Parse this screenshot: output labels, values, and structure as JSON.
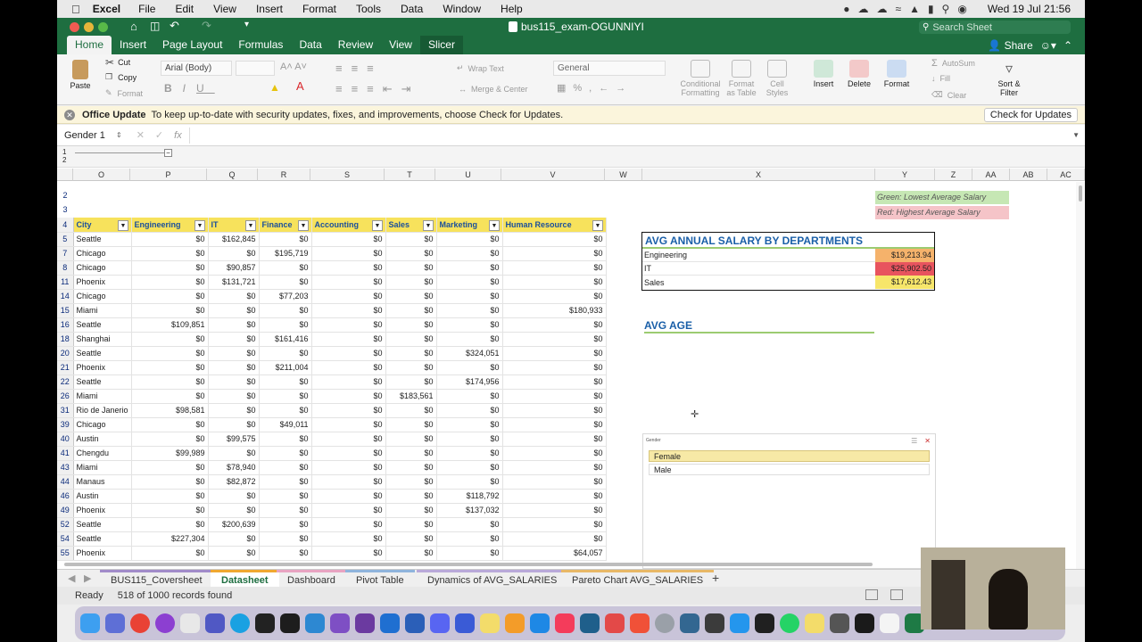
{
  "menubar": {
    "app": "Excel",
    "items": [
      "File",
      "Edit",
      "View",
      "Insert",
      "Format",
      "Tools",
      "Data",
      "Window",
      "Help"
    ],
    "clock": "Wed 19 Jul  21:56"
  },
  "window": {
    "title": "bus115_exam-OGUNNIYI",
    "search_placeholder": "Search Sheet",
    "share": "Share"
  },
  "ribbon_tabs": [
    "Home",
    "Insert",
    "Page Layout",
    "Formulas",
    "Data",
    "Review",
    "View",
    "Slicer"
  ],
  "ribbon": {
    "paste": "Paste",
    "cut": "Cut",
    "copy": "Copy",
    "format": "Format",
    "font": "Arial (Body)",
    "wrap_text": "Wrap Text",
    "merge_center": "Merge & Center",
    "number_format": "General",
    "conditional_formatting": "Conditional Formatting",
    "format_as_table": "Format as Table",
    "cell_styles": "Cell Styles",
    "insert": "Insert",
    "delete": "Delete",
    "format_cells": "Format",
    "autosum": "AutoSum",
    "fill": "Fill",
    "clear": "Clear",
    "sort_filter": "Sort & Filter"
  },
  "update_bar": {
    "title": "Office Update",
    "message": "To keep up-to-date with security updates, fixes, and improvements, choose Check for Updates.",
    "button": "Check for Updates"
  },
  "formula_bar": {
    "name_box": "Gender 1",
    "fx": "fx"
  },
  "columns": [
    "O",
    "P",
    "Q",
    "R",
    "S",
    "T",
    "U",
    "V",
    "W",
    "X",
    "Y",
    "Z",
    "AA",
    "AB",
    "AC"
  ],
  "table": {
    "headers": [
      "City",
      "Engineering",
      "IT",
      "Finance",
      "Accounting",
      "Sales",
      "Marketing",
      "Human Resource"
    ],
    "rows": [
      {
        "rn": "5",
        "cells": [
          "Seattle",
          "$0",
          "$162,845",
          "$0",
          "$0",
          "$0",
          "$0",
          "$0"
        ]
      },
      {
        "rn": "7",
        "cells": [
          "Chicago",
          "$0",
          "$0",
          "$195,719",
          "$0",
          "$0",
          "$0",
          "$0"
        ]
      },
      {
        "rn": "8",
        "cells": [
          "Chicago",
          "$0",
          "$90,857",
          "$0",
          "$0",
          "$0",
          "$0",
          "$0"
        ]
      },
      {
        "rn": "11",
        "cells": [
          "Phoenix",
          "$0",
          "$131,721",
          "$0",
          "$0",
          "$0",
          "$0",
          "$0"
        ]
      },
      {
        "rn": "14",
        "cells": [
          "Chicago",
          "$0",
          "$0",
          "$77,203",
          "$0",
          "$0",
          "$0",
          "$0"
        ]
      },
      {
        "rn": "15",
        "cells": [
          "Miami",
          "$0",
          "$0",
          "$0",
          "$0",
          "$0",
          "$0",
          "$180,933"
        ]
      },
      {
        "rn": "16",
        "cells": [
          "Seattle",
          "$109,851",
          "$0",
          "$0",
          "$0",
          "$0",
          "$0",
          "$0"
        ]
      },
      {
        "rn": "18",
        "cells": [
          "Shanghai",
          "$0",
          "$0",
          "$161,416",
          "$0",
          "$0",
          "$0",
          "$0"
        ]
      },
      {
        "rn": "20",
        "cells": [
          "Seattle",
          "$0",
          "$0",
          "$0",
          "$0",
          "$0",
          "$324,051",
          "$0"
        ]
      },
      {
        "rn": "21",
        "cells": [
          "Phoenix",
          "$0",
          "$0",
          "$211,004",
          "$0",
          "$0",
          "$0",
          "$0"
        ]
      },
      {
        "rn": "22",
        "cells": [
          "Seattle",
          "$0",
          "$0",
          "$0",
          "$0",
          "$0",
          "$174,956",
          "$0"
        ]
      },
      {
        "rn": "26",
        "cells": [
          "Miami",
          "$0",
          "$0",
          "$0",
          "$0",
          "$183,561",
          "$0",
          "$0"
        ]
      },
      {
        "rn": "31",
        "cells": [
          "Rio de Janerio",
          "$98,581",
          "$0",
          "$0",
          "$0",
          "$0",
          "$0",
          "$0"
        ]
      },
      {
        "rn": "39",
        "cells": [
          "Chicago",
          "$0",
          "$0",
          "$49,011",
          "$0",
          "$0",
          "$0",
          "$0"
        ]
      },
      {
        "rn": "40",
        "cells": [
          "Austin",
          "$0",
          "$99,575",
          "$0",
          "$0",
          "$0",
          "$0",
          "$0"
        ]
      },
      {
        "rn": "41",
        "cells": [
          "Chengdu",
          "$99,989",
          "$0",
          "$0",
          "$0",
          "$0",
          "$0",
          "$0"
        ]
      },
      {
        "rn": "43",
        "cells": [
          "Miami",
          "$0",
          "$78,940",
          "$0",
          "$0",
          "$0",
          "$0",
          "$0"
        ]
      },
      {
        "rn": "44",
        "cells": [
          "Manaus",
          "$0",
          "$82,872",
          "$0",
          "$0",
          "$0",
          "$0",
          "$0"
        ]
      },
      {
        "rn": "46",
        "cells": [
          "Austin",
          "$0",
          "$0",
          "$0",
          "$0",
          "$0",
          "$118,792",
          "$0"
        ]
      },
      {
        "rn": "49",
        "cells": [
          "Phoenix",
          "$0",
          "$0",
          "$0",
          "$0",
          "$0",
          "$137,032",
          "$0"
        ]
      },
      {
        "rn": "52",
        "cells": [
          "Seattle",
          "$0",
          "$200,639",
          "$0",
          "$0",
          "$0",
          "$0",
          "$0"
        ]
      },
      {
        "rn": "54",
        "cells": [
          "Seattle",
          "$227,304",
          "$0",
          "$0",
          "$0",
          "$0",
          "$0",
          "$0"
        ]
      },
      {
        "rn": "55",
        "cells": [
          "Phoenix",
          "$0",
          "$0",
          "$0",
          "$0",
          "$0",
          "$0",
          "$64,057"
        ]
      }
    ]
  },
  "legend": {
    "green": "Green: Lowest Average Salary",
    "red": "Red: Highest Average Salary",
    "green_color": "#c6e7b4",
    "red_color": "#f5c4c8"
  },
  "avg_salary": {
    "title": "AVG ANNUAL SALARY BY DEPARTMENTS",
    "rows": [
      {
        "dept": "Engineering",
        "value": "$19,213.94",
        "color": "#f5b26b"
      },
      {
        "dept": "IT",
        "value": "$25,902.50",
        "color": "#e8545e"
      },
      {
        "dept": "Sales",
        "value": "$17,612.43",
        "color": "#f7e66a"
      }
    ]
  },
  "avg_age": {
    "title": "AVG AGE"
  },
  "slicer": {
    "title": "Gender",
    "items": [
      "Female",
      "Male"
    ]
  },
  "sheet_tabs": [
    "BUS115_Coversheet",
    "Datasheet",
    "Dashboard",
    "Pivot Table",
    "Dynamics of AVG_SALARIES",
    "Pareto Chart AVG_SALARIES"
  ],
  "status": {
    "ready": "Ready",
    "records": "518 of 1000 records found"
  }
}
